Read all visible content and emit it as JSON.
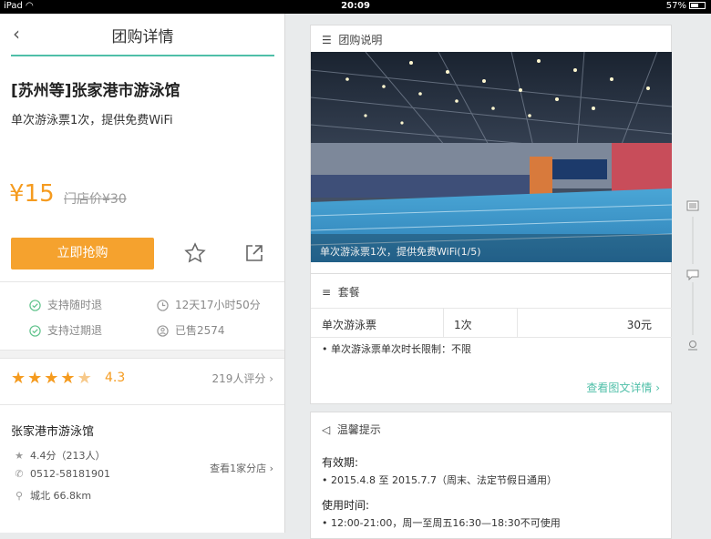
{
  "status_bar": {
    "device": "iPad",
    "time": "20:09",
    "battery": "57%",
    "battery_level": 0.57
  },
  "nav": {
    "title": "团购详情"
  },
  "deal": {
    "title": "[苏州等]张家港市游泳馆",
    "subtitle": "单次游泳票1次，提供免费WiFi",
    "price": "¥15",
    "original_price": "门店价¥30",
    "buy_button": "立即抢购"
  },
  "features": [
    {
      "icon": "check-circle-icon",
      "text": "支持随时退"
    },
    {
      "icon": "clock-icon",
      "text": "12天17小时50分"
    },
    {
      "icon": "check-circle-icon",
      "text": "支持过期退"
    },
    {
      "icon": "user-circle-icon",
      "text": "已售2574"
    }
  ],
  "rating": {
    "stars": 4.5,
    "score": "4.3",
    "reviews": "219人评分"
  },
  "shop": {
    "name": "张家港市游泳馆",
    "score": "4.4分（213人）",
    "phone": "0512-58181901",
    "distance": "城北 66.8km",
    "branches": "查看1家分店"
  },
  "description": {
    "header": "团购说明",
    "photo_caption": "单次游泳票1次，提供免费WiFi(1/5)"
  },
  "package": {
    "header": "套餐",
    "rows": [
      {
        "name": "单次游泳票",
        "qty": "1次",
        "price": "30元"
      }
    ],
    "note": "• 单次游泳票单次时长限制：不限",
    "more": "查看图文详情"
  },
  "tips": {
    "header": "温馨提示",
    "validity_label": "有效期:",
    "validity": "•   2015.4.8 至 2015.7.7（周末、法定节假日通用）",
    "hours_label": "使用时间:",
    "hours": "•   12:00-21:00，周一至周五16:30—18:30不可使用"
  },
  "colors": {
    "accent": "#4fbfa8",
    "price": "#f59b1f",
    "button": "#f5a22e"
  }
}
